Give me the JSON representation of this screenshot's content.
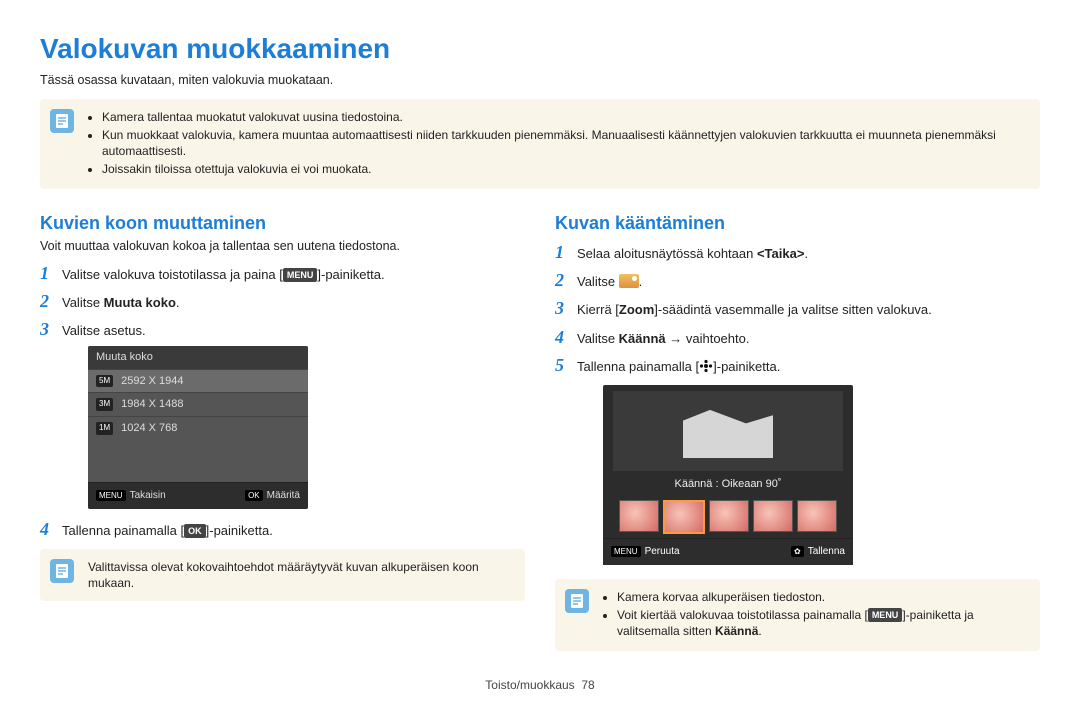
{
  "page": {
    "title": "Valokuvan muokkaaminen",
    "intro": "Tässä osassa kuvataan, miten valokuvia muokataan.",
    "footer_section": "Toisto/muokkaus",
    "footer_page": "78"
  },
  "topnote": {
    "items": [
      "Kamera tallentaa muokatut valokuvat uusina tiedostoina.",
      "Kun muokkaat valokuvia, kamera muuntaa automaattisesti niiden tarkkuuden pienemmäksi. Manuaalisesti käännettyjen valokuvien tarkkuutta ei muunneta pienemmäksi automaattisesti.",
      "Joissakin tiloissa otettuja valokuvia ei voi muokata."
    ]
  },
  "left": {
    "heading": "Kuvien koon muuttaminen",
    "lead": "Voit muuttaa valokuvan kokoa ja tallentaa sen uutena tiedostona.",
    "steps": {
      "s1a": "Valitse valokuva toistotilassa ja paina [",
      "s1chip": "MENU",
      "s1b": "]-painiketta.",
      "s2a": "Valitse ",
      "s2b": "Muuta koko",
      "s2c": ".",
      "s3": "Valitse asetus.",
      "s4a": "Tallenna painamalla [",
      "s4chip": "OK",
      "s4b": "]-painiketta."
    },
    "camscreen": {
      "title": "Muuta koko",
      "rows": [
        {
          "badge": "5M",
          "text": "2592 X 1944"
        },
        {
          "badge": "3M",
          "text": "1984 X 1488"
        },
        {
          "badge": "1M",
          "text": "1024 X 768"
        }
      ],
      "footer_left_chip": "MENU",
      "footer_left": "Takaisin",
      "footer_right_chip": "OK",
      "footer_right": "Määritä"
    },
    "note": "Valittavissa olevat kokovaihtoehdot määräytyvät kuvan alkuperäisen koon mukaan."
  },
  "right": {
    "heading": "Kuvan kääntäminen",
    "steps": {
      "s1a": "Selaa aloitusnäytössä kohtaan ",
      "s1b": "<Taika>",
      "s1c": ".",
      "s2a": "Valitse ",
      "s2b": ".",
      "s3a": "Kierrä [",
      "s3b": "Zoom",
      "s3c": "]-säädintä vasemmalle ja valitse sitten valokuva.",
      "s4a": "Valitse ",
      "s4b": "Käännä",
      "s4c": " → vaihtoehto.",
      "s5a": "Tallenna painamalla [",
      "s5b": "]-painiketta."
    },
    "rot": {
      "caption": "Käännä : Oikeaan 90˚",
      "footer_left_chip": "MENU",
      "footer_left": "Peruuta",
      "footer_right": "Tallenna"
    },
    "note": {
      "items_a": "Kamera korvaa alkuperäisen tiedoston.",
      "items_b1": "Voit kiertää valokuvaa toistotilassa painamalla [",
      "items_b_chip": "MENU",
      "items_b2": "]-painiketta ja valitsemalla sitten ",
      "items_b_bold": "Käännä",
      "items_b3": "."
    }
  }
}
